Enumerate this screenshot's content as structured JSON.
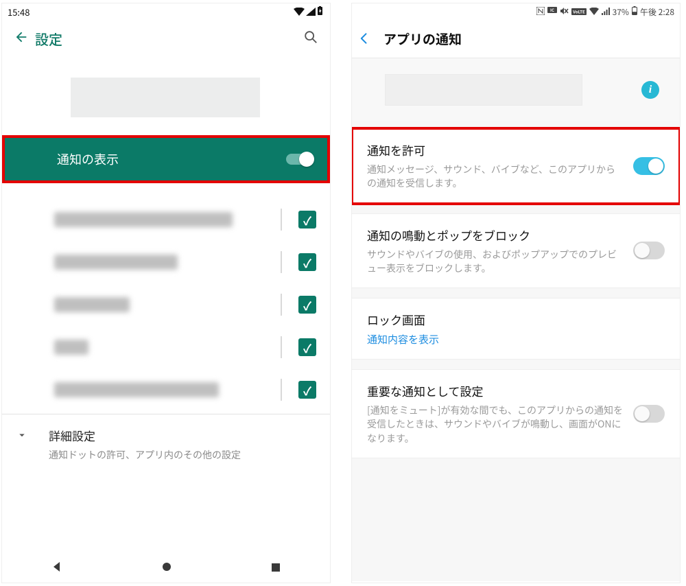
{
  "left": {
    "statusbar": {
      "time": "15:48"
    },
    "appbar": {
      "title": "設定"
    },
    "show_notifications": {
      "label": "通知の表示",
      "on": true
    },
    "advanced": {
      "title": "詳細設定",
      "subtitle": "通知ドットの許可、アプリ内のその他の設定"
    }
  },
  "right": {
    "statusbar": {
      "battery": "37%",
      "time": "午後 2:28"
    },
    "appbar": {
      "title": "アプリの通知"
    },
    "allow": {
      "title": "通知を許可",
      "subtitle": "通知メッセージ、サウンド、バイブなど、このアプリからの通知を受信します。",
      "on": true
    },
    "block_popup": {
      "title": "通知の鳴動とポップをブロック",
      "subtitle": "サウンドやバイブの使用、およびポップアップでのプレビュー表示をブロックします。",
      "on": false
    },
    "lockscreen": {
      "title": "ロック画面",
      "value": "通知内容を表示"
    },
    "important": {
      "title": "重要な通知として設定",
      "subtitle": "[通知をミュート]が有効な間でも、このアプリからの通知を受信したときは、サウンドやバイブが鳴動し、画面がONになります。",
      "on": false
    }
  }
}
